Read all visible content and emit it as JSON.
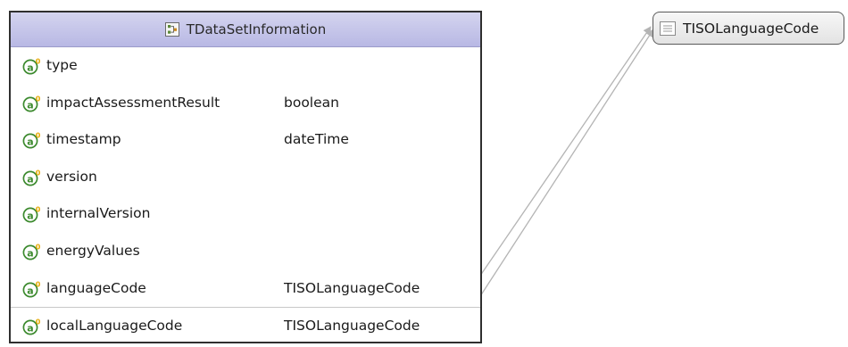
{
  "class": {
    "name": "TDataSetInformation",
    "attributes": [
      {
        "name": "type",
        "type": ""
      },
      {
        "name": "impactAssessmentResult",
        "type": "boolean"
      },
      {
        "name": "timestamp",
        "type": "dateTime"
      },
      {
        "name": "version",
        "type": ""
      },
      {
        "name": "internalVersion",
        "type": ""
      },
      {
        "name": "energyValues",
        "type": ""
      },
      {
        "name": "languageCode",
        "type": "TISOLanguageCode"
      },
      {
        "name": "localLanguageCode",
        "type": "TISOLanguageCode"
      }
    ]
  },
  "enumeration": {
    "name": "TISOLanguageCode"
  },
  "colors": {
    "header_bg": "#c6c6ea",
    "attribute_icon": "#3c8a2e",
    "attribute_badge": "#e5a800",
    "connector": "#b4b4b4"
  },
  "icons": {
    "class_header": "class-icon",
    "attribute": "attribute-icon",
    "enumeration": "enumeration-icon"
  }
}
